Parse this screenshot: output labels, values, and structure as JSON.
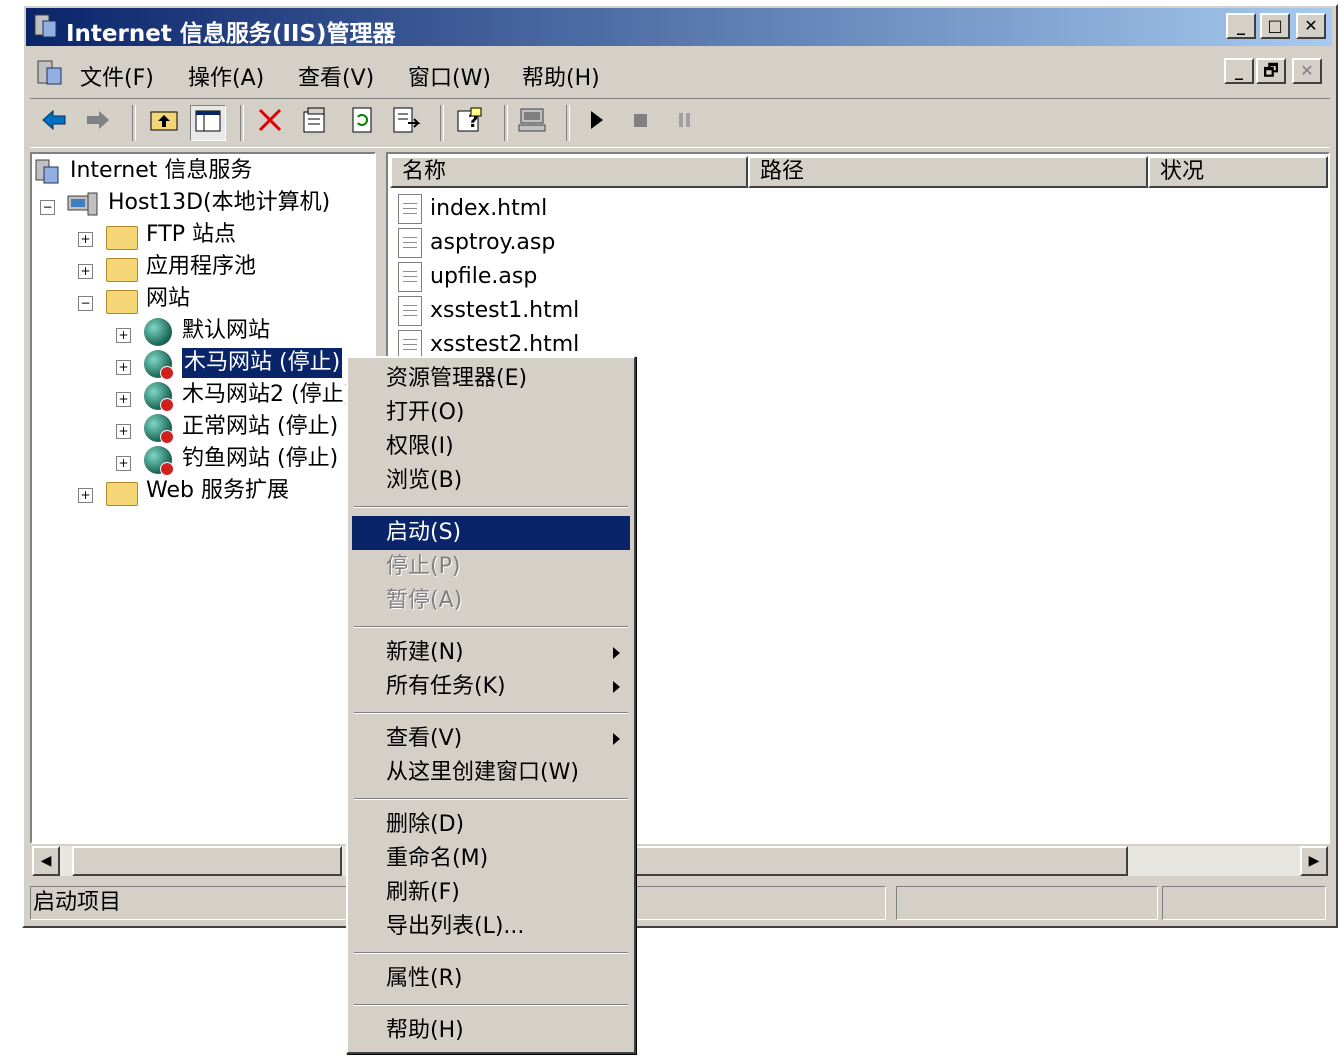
{
  "window": {
    "title": "Internet 信息服务(IIS)管理器",
    "minimize": "_",
    "maximize": "□",
    "close": "✕"
  },
  "menubar": {
    "items": [
      "文件(F)",
      "操作(A)",
      "查看(V)",
      "窗口(W)",
      "帮助(H)"
    ],
    "mdi_min": "_",
    "mdi_restore": "🗗",
    "mdi_close": "✕"
  },
  "toolbar": {
    "icons": [
      "back-arrow-icon",
      "forward-arrow-icon",
      "up-folder-icon",
      "show-hide-tree-icon",
      "delete-icon",
      "properties-icon",
      "refresh-icon",
      "export-icon",
      "help-icon",
      "computer-icon",
      "play-icon",
      "stop-icon",
      "pause-icon"
    ]
  },
  "tree": {
    "root": "Internet 信息服务",
    "host": "Host13D(本地计算机)",
    "ftp": "FTP 站点",
    "apppool": "应用程序池",
    "websites": "网站",
    "sites": [
      "默认网站",
      "木马网站 (停止)",
      "木马网站2 (停止)",
      "正常网站 (停止)",
      "钓鱼网站 (停止)"
    ],
    "webext": "Web 服务扩展",
    "selected": "木马网站 (停止)"
  },
  "list": {
    "columns": [
      "名称",
      "路径",
      "状况"
    ],
    "files": [
      "index.html",
      "asptroy.asp",
      "upfile.asp",
      "xsstest1.html",
      "xsstest2.html"
    ]
  },
  "status": {
    "text": "启动项目"
  },
  "context_menu": {
    "items": [
      {
        "label": "资源管理器(E)",
        "disabled": false
      },
      {
        "label": "打开(O)",
        "disabled": false
      },
      {
        "label": "权限(I)",
        "disabled": false
      },
      {
        "label": "浏览(B)",
        "disabled": false
      },
      {
        "label": "启动(S)",
        "highlighted": true
      },
      {
        "label": "停止(P)",
        "disabled": true
      },
      {
        "label": "暂停(A)",
        "disabled": true
      },
      {
        "label": "新建(N)",
        "submenu": true
      },
      {
        "label": "所有任务(K)",
        "submenu": true
      },
      {
        "label": "查看(V)",
        "submenu": true
      },
      {
        "label": "从这里创建窗口(W)"
      },
      {
        "label": "删除(D)"
      },
      {
        "label": "重命名(M)"
      },
      {
        "label": "刷新(F)"
      },
      {
        "label": "导出列表(L)..."
      },
      {
        "label": "属性(R)"
      },
      {
        "label": "帮助(H)"
      }
    ]
  },
  "colors": {
    "face": "#d4d0c8",
    "title_start": "#0a246a",
    "title_end": "#a6caf0",
    "highlight": "#0a246a"
  }
}
